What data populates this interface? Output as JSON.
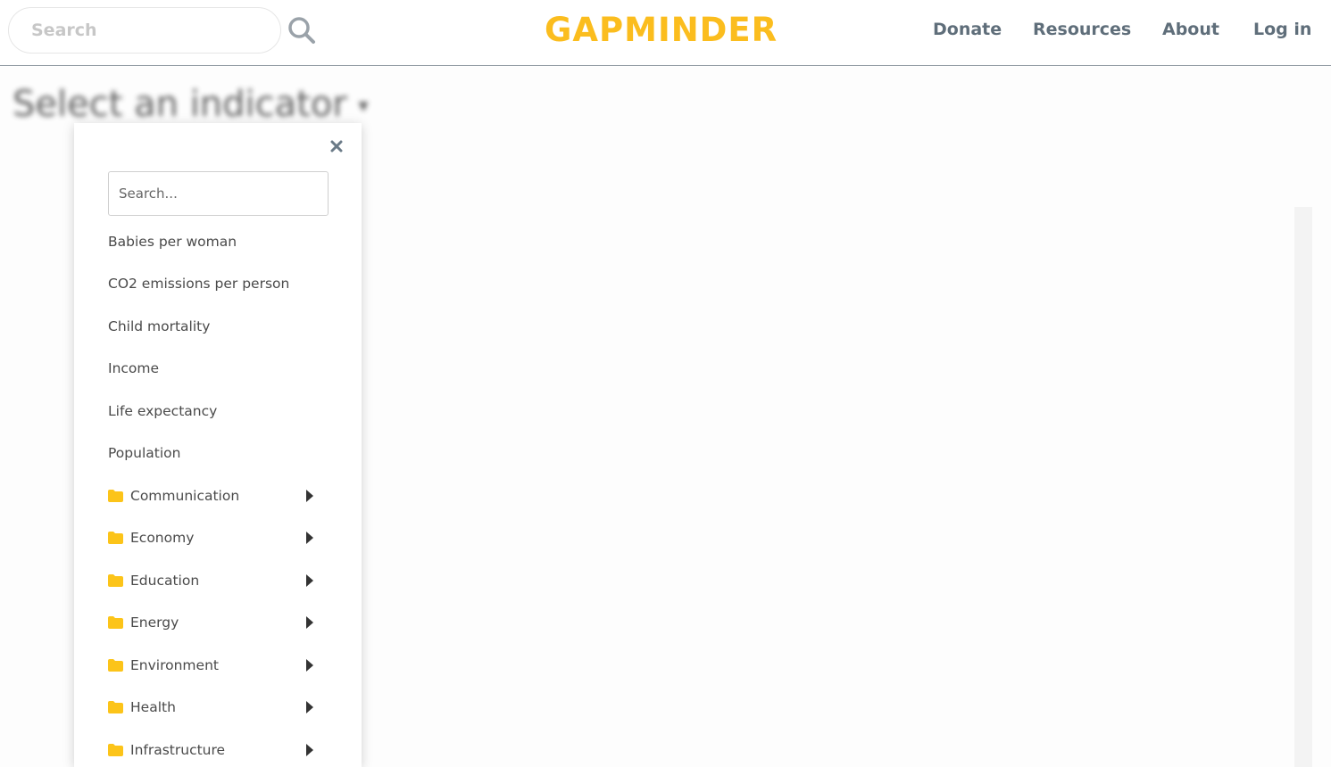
{
  "header": {
    "search_placeholder": "Search",
    "logo_text": "GAPMINDER",
    "nav": {
      "donate": "Donate",
      "resources": "Resources",
      "about": "About",
      "login": "Log in"
    },
    "brand_color": "#fbbd1e",
    "nav_color": "#5f6e7a"
  },
  "page": {
    "select_title": "Select an indicator",
    "select_caret": "▾"
  },
  "dropdown": {
    "search_placeholder": "Search...",
    "items": [
      "Babies per woman",
      "CO2 emissions per person",
      "Child mortality",
      "Income",
      "Life expectancy",
      "Population"
    ],
    "folders": [
      "Communication",
      "Economy",
      "Education",
      "Energy",
      "Environment",
      "Health",
      "Infrastructure"
    ],
    "icons": {
      "close": "close-icon",
      "folder": "folder-icon",
      "expand": "caret-right-icon"
    },
    "folder_color": "#fbbd1e"
  }
}
